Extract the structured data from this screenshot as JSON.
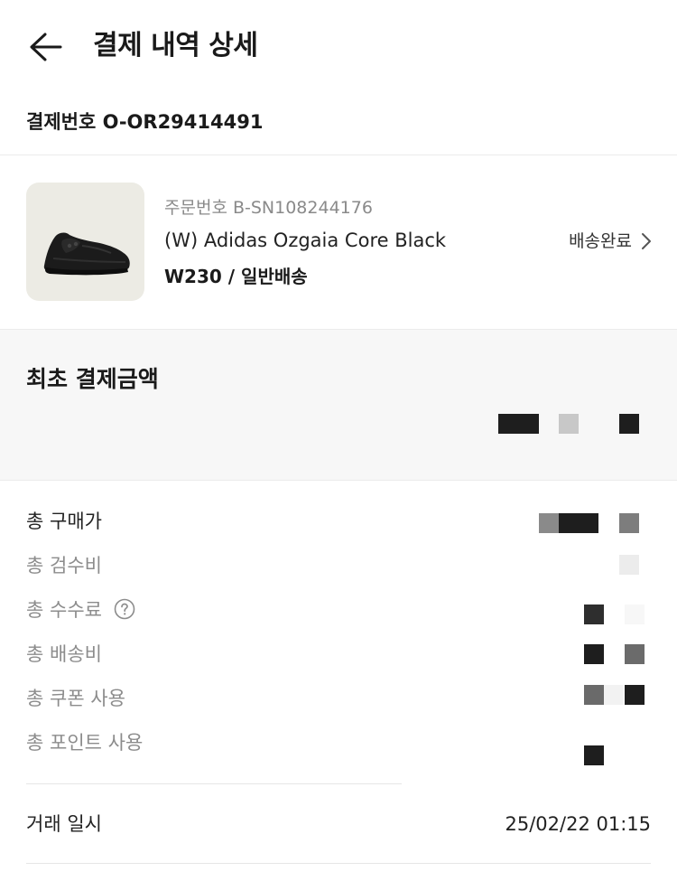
{
  "header": {
    "title": "결제 내역 상세",
    "back_icon": "arrow-left-icon"
  },
  "payment": {
    "number_label": "결제번호",
    "number_value": "O-OR29414491"
  },
  "product": {
    "order_label": "주문번호",
    "order_value": "B-SN108244176",
    "name": "(W) Adidas Ozgaia Core Black",
    "option": "W230 / 일반배송",
    "status": "배송완료",
    "status_icon": "chevron-right-icon",
    "thumbnail": "black-sneaker-image"
  },
  "summary": {
    "title": "최초 결제금액"
  },
  "breakdown": [
    {
      "label": "총 구매가"
    },
    {
      "label": "총 검수비"
    },
    {
      "label": "총 수수료",
      "help_icon": "question-circle-icon"
    },
    {
      "label": "총 배송비"
    },
    {
      "label": "총 쿠폰 사용"
    },
    {
      "label": "총 포인트 사용"
    }
  ],
  "transaction": {
    "label": "거래 일시",
    "value": "25/02/22 01:15"
  },
  "colors": {
    "text_primary": "#222222",
    "text_secondary": "#8c8c8c",
    "thumb_bg": "#ecebe4",
    "section_bg": "#f7f7f7"
  }
}
